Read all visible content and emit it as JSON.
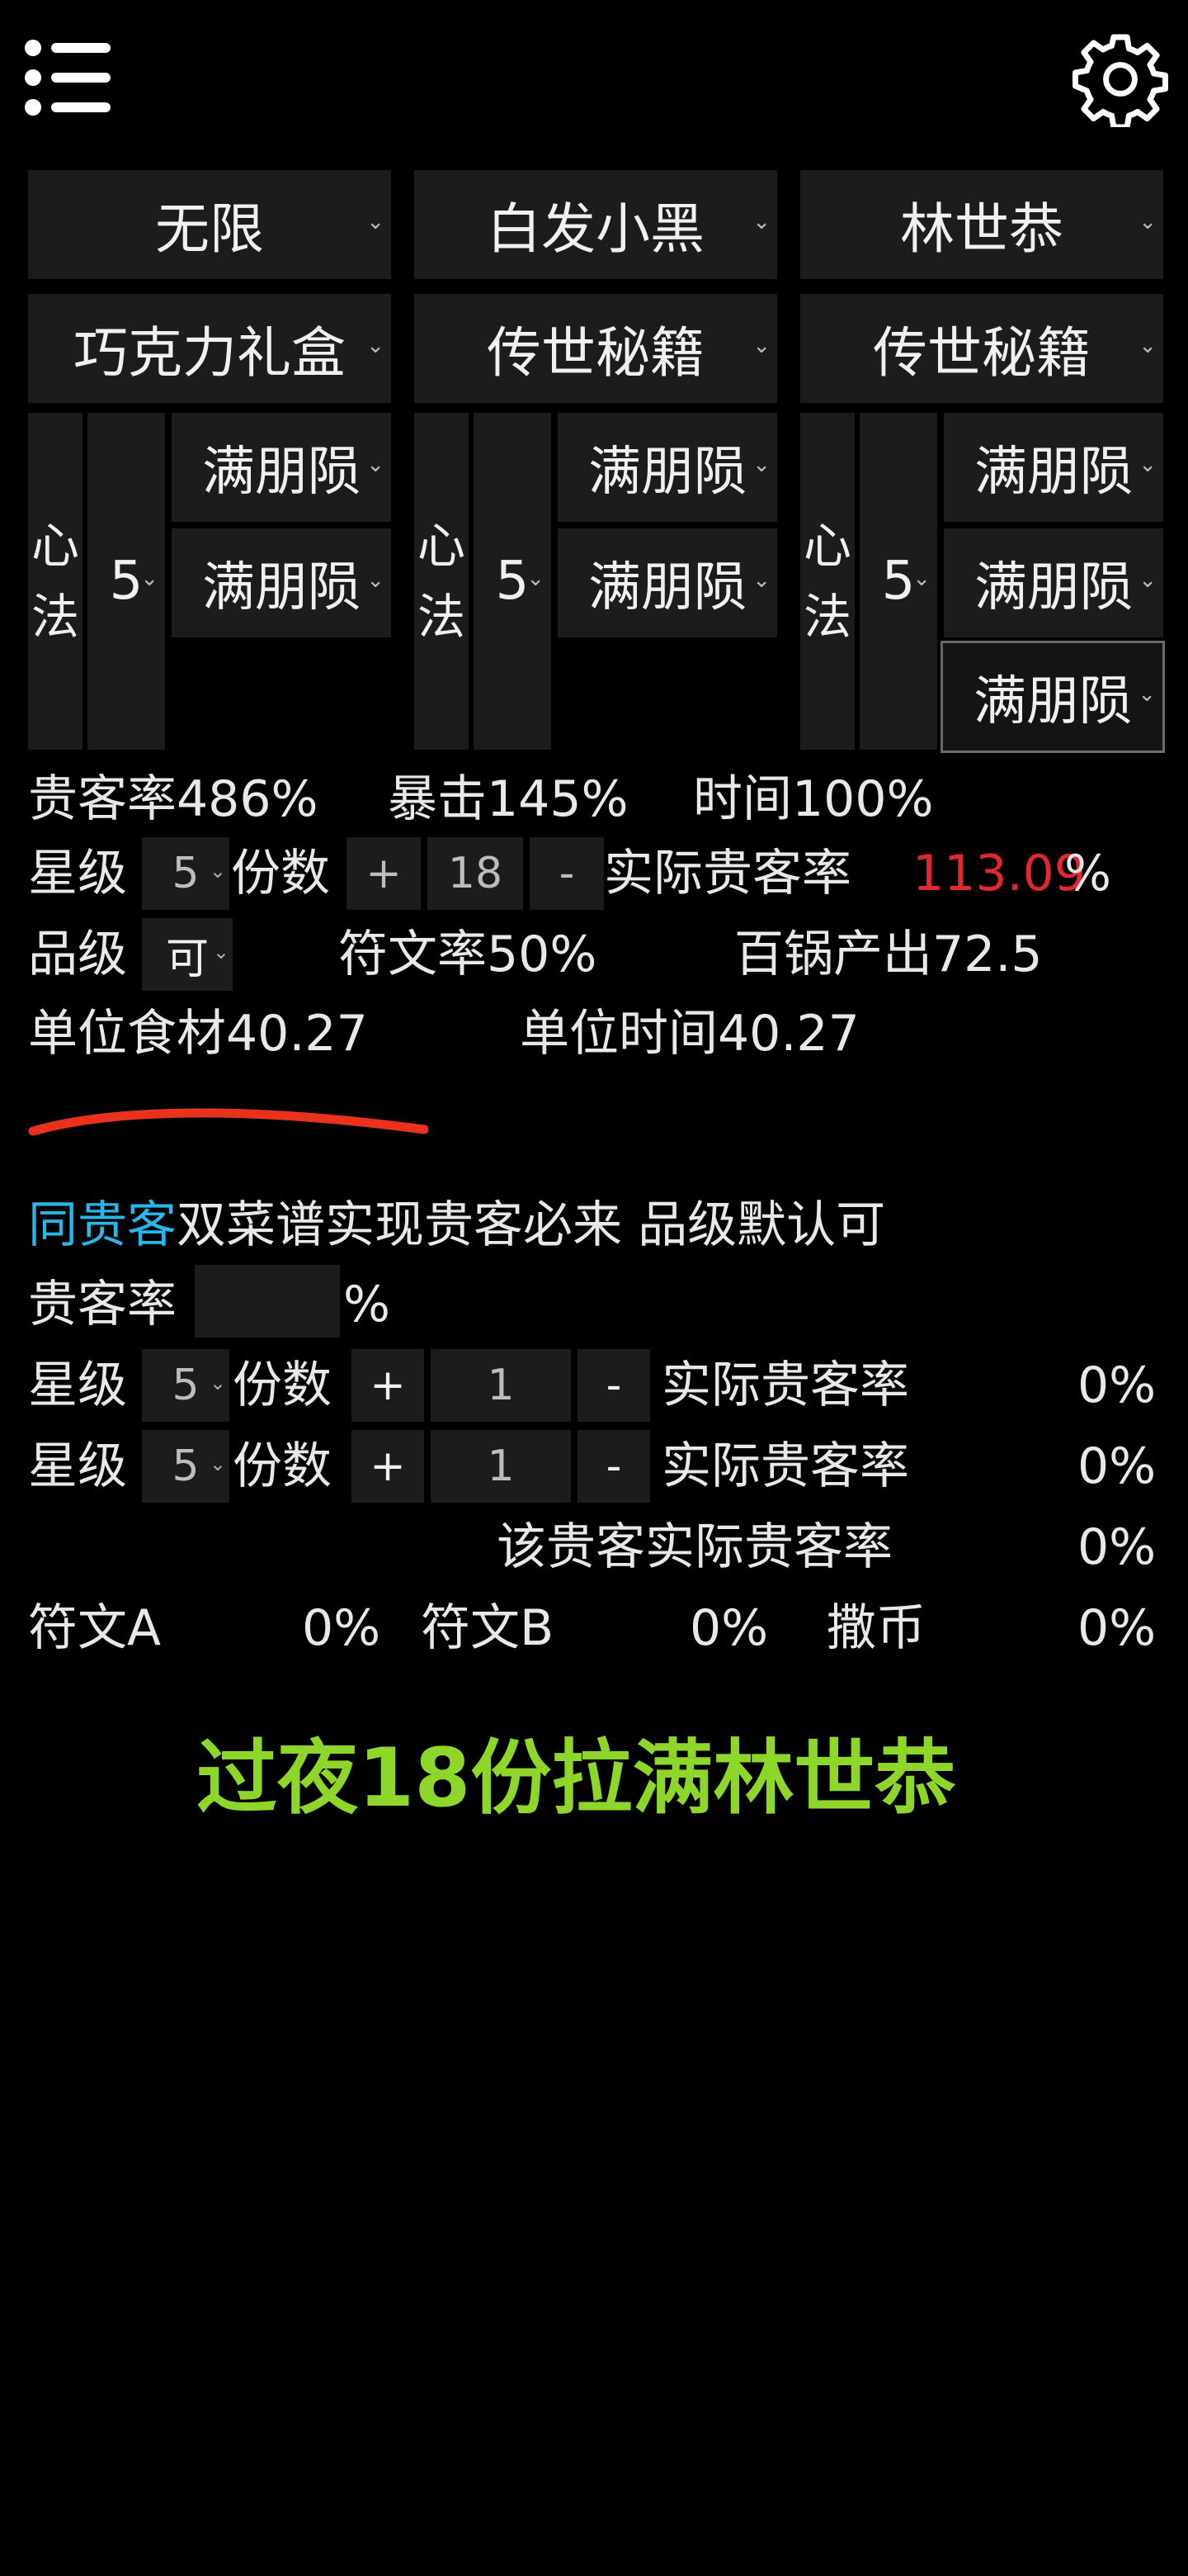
{
  "header": {
    "menu_icon": "menu-icon",
    "settings_icon": "gear-icon"
  },
  "columns": [
    {
      "chef": "无限",
      "item": "巧克力礼盒",
      "skill_type": "心法",
      "skill_level": "5",
      "skills": [
        "满朋陨",
        "满朋陨"
      ]
    },
    {
      "chef": "白发小黑",
      "item": "传世秘籍",
      "skill_type": "心法",
      "skill_level": "5",
      "skills": [
        "满朋陨",
        "满朋陨"
      ]
    },
    {
      "chef": "林世恭",
      "item": "传世秘籍",
      "skill_type": "心法",
      "skill_level": "5",
      "skills": [
        "满朋陨",
        "满朋陨",
        "满朋陨"
      ]
    }
  ],
  "stats": {
    "guest_rate": "贵客率486%",
    "crit": "暴击145%",
    "time": "时间100%",
    "star_label": "星级",
    "star_value": "5",
    "portion_label": "份数",
    "plus": "+",
    "portion_value": "18",
    "minus": "-",
    "actual_rate_label": "实际贵客率",
    "actual_rate_value": "113.09",
    "percent": "%",
    "grade_label": "品级",
    "grade_value": "可",
    "rune_rate": "符文率50%",
    "pot_output": "百锅产出72.5",
    "unit_food": "单位食材40.27",
    "unit_time": "单位时间40.27"
  },
  "same_guest": {
    "title_highlight": "同贵客",
    "title_rest": "双菜谱实现贵客必来 品级默认可",
    "rate_label": "贵客率",
    "rate_value": "",
    "percent": "%",
    "rows": [
      {
        "star_label": "星级",
        "star": "5",
        "portion_label": "份数",
        "plus": "+",
        "portion": "1",
        "minus": "-",
        "actual_label": "实际贵客率",
        "actual": "0%"
      },
      {
        "star_label": "星级",
        "star": "5",
        "portion_label": "份数",
        "plus": "+",
        "portion": "1",
        "minus": "-",
        "actual_label": "实际贵客率",
        "actual": "0%"
      }
    ],
    "guest_actual_label": "该贵客实际贵客率",
    "guest_actual_value": "0%",
    "rune_a_label": "符文A",
    "rune_a_value": "0%",
    "rune_b_label": "符文B",
    "rune_b_value": "0%",
    "coin_label": "撒币",
    "coin_value": "0%"
  },
  "caption": "过夜18份拉满林世恭",
  "colors": {
    "accent_red": "#e0282e",
    "accent_cyan": "#29b6e8",
    "caption_green": "#8fd62a",
    "underline": "#e8321e"
  }
}
